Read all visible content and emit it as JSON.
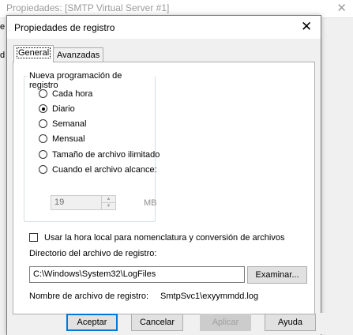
{
  "background": {
    "window_title": "Propiedades: [SMTP Virtual Server #1]",
    "close_glyph": "✕",
    "left_text_1": "en",
    "left_text_2": "d"
  },
  "dialog": {
    "title": "Propiedades de registro",
    "close_glyph": "✕",
    "tabs": [
      {
        "label": "General",
        "active": true
      },
      {
        "label": "Avanzadas",
        "active": false
      }
    ]
  },
  "schedule": {
    "legend": "Nueva programación de registro",
    "options": [
      {
        "label": "Cada hora",
        "checked": false
      },
      {
        "label": "Diario",
        "checked": true
      },
      {
        "label": "Semanal",
        "checked": false
      },
      {
        "label": "Mensual",
        "checked": false
      },
      {
        "label": "Tamaño de archivo ilimitado",
        "checked": false
      },
      {
        "label": "Cuando el archivo alcance:",
        "checked": false
      }
    ],
    "size_value": "19",
    "size_unit": "MB",
    "spin_up_glyph": "▲",
    "spin_down_glyph": "▼"
  },
  "local_time": {
    "label": "Usar la hora local para nomenclatura y conversión de archivos",
    "checked": false
  },
  "directory": {
    "label": "Directorio del archivo de registro:",
    "value": "C:\\Windows\\System32\\LogFiles",
    "browse_label": "Examinar..."
  },
  "file_name": {
    "label": "Nombre de archivo de registro:",
    "value": "SmtpSvc1\\exyymmdd.log"
  },
  "buttons": {
    "ok": "Aceptar",
    "cancel": "Cancelar",
    "apply": "Aplicar",
    "help": "Ayuda"
  }
}
